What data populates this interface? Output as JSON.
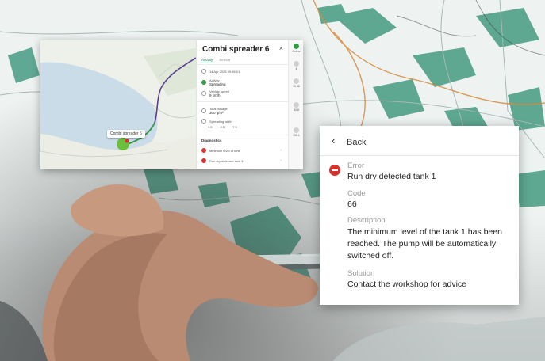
{
  "map_window": {
    "marker_label": "Combi spreader 6",
    "panel": {
      "title": "Combi spreader 6",
      "close": "×",
      "tabs": [
        "Activity",
        "Sensor"
      ],
      "timestamp": "14 Apr 2024 09:36:01",
      "activity_label": "Activity",
      "activity_value": "Spreading",
      "speed_label": "Vehicle speed",
      "speed_value": "9 km/h",
      "dosage_label": "Total dosage",
      "dosage_value": "300 g/m²",
      "width_label": "Spreading width",
      "width_values": [
        "1.5",
        "2.5",
        "7.5"
      ],
      "diagnostics_title": "Diagnostics",
      "diagnostics": [
        "Minimum level of tank",
        "Run dry detected tank 1"
      ]
    },
    "rail": {
      "items": [
        "Online",
        "4",
        "10.88",
        "40.8",
        "195.1"
      ]
    }
  },
  "detail_card": {
    "back_label": "Back",
    "fields": [
      {
        "label": "Error",
        "value": "Run dry detected tank 1"
      },
      {
        "label": "Code",
        "value": "66"
      },
      {
        "label": "Description",
        "value": "The minimum level of the tank 1 has been reached. The pump will be automatically switched off."
      },
      {
        "label": "Solution",
        "value": "Contact the workshop for advice"
      }
    ]
  },
  "colors": {
    "accent_green": "#1d7e55",
    "error_red": "#d6322e",
    "route_purple": "#5b3f8f"
  },
  "icons": [
    "back-chevron-icon",
    "error-icon",
    "close-icon",
    "clock-icon",
    "speed-icon",
    "dosage-icon",
    "width-icon"
  ]
}
